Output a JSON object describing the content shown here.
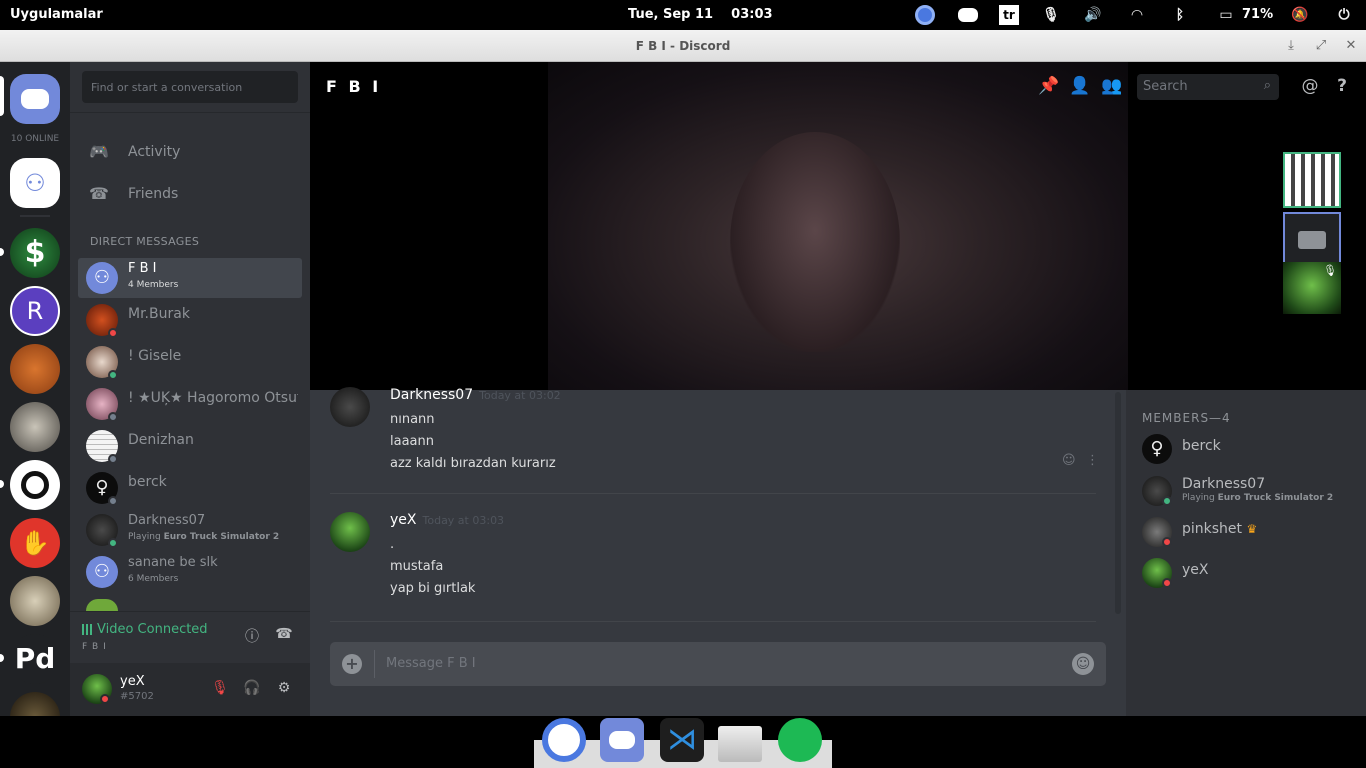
{
  "system_bar": {
    "apps_label": "Uygulamalar",
    "clock": "Tue, Sep 11    03:03",
    "keyboard_layout": "tr",
    "battery": "71%"
  },
  "window": {
    "title": "F B I - Discord"
  },
  "servers": {
    "online_count": "10 ONLINE",
    "r_letter": "R"
  },
  "dm_sidebar": {
    "search_placeholder": "Find or start a conversation",
    "nav": [
      {
        "label": "Activity",
        "icon": "gamepad-icon"
      },
      {
        "label": "Friends",
        "icon": "friends-icon"
      }
    ],
    "section_header": "DIRECT MESSAGES",
    "items": [
      {
        "name": "F B I",
        "sub": "4 Members",
        "selected": true
      },
      {
        "name": "Mr.Burak",
        "sub": "",
        "status": "dnd"
      },
      {
        "name": "! Gisele",
        "sub": "",
        "status": "on"
      },
      {
        "name": "! ★ÜĶ★ Hagoromo Ötsutsuki",
        "sub": "",
        "status": "off"
      },
      {
        "name": "Denizhan",
        "sub": "",
        "status": "off"
      },
      {
        "name": "berck",
        "sub": "",
        "status": "off"
      },
      {
        "name": "Darkness07",
        "sub": "Playing ",
        "sub_bold": "Euro Truck Simulator 2",
        "status": "on"
      },
      {
        "name": "sanane be slk",
        "sub": "6 Members"
      }
    ]
  },
  "voice": {
    "status": "Video Connected",
    "channel": "F B I"
  },
  "user": {
    "name": "yeX",
    "tag": "#5702"
  },
  "chat": {
    "channel_name": "F B I",
    "search_placeholder": "Search",
    "messages": [
      {
        "author": "Darkness07",
        "time": "Today at 03:02",
        "lines": [
          "nınann",
          "laaann",
          "azz kaldı bırazdan kurarız"
        ]
      },
      {
        "author": "yeX",
        "time": "Today at 03:03",
        "lines": [
          ".",
          "mustafa",
          "yap bi gırtlak"
        ]
      }
    ],
    "input_placeholder": "Message F B I"
  },
  "members": {
    "header": "MEMBERS—4",
    "list": [
      {
        "name": "berck",
        "sub": "",
        "sub_bold": ""
      },
      {
        "name": "Darkness07",
        "sub": "Playing ",
        "sub_bold": "Euro Truck Simulator 2"
      },
      {
        "name": "pinkshet",
        "sub": "",
        "sub_bold": ""
      },
      {
        "name": "yeX",
        "sub": "",
        "sub_bold": ""
      }
    ]
  },
  "colors": {
    "blurple": "#7289da",
    "online": "#43b581",
    "dnd": "#f04747",
    "background": "#36393f"
  }
}
